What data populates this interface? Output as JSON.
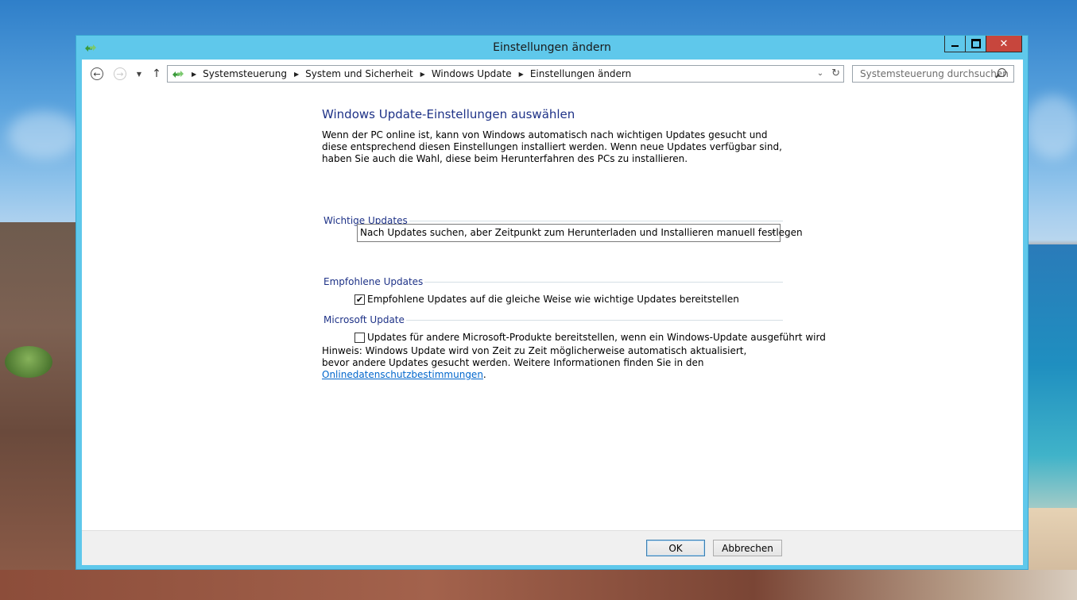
{
  "window": {
    "title": "Einstellungen ändern",
    "close_glyph": "✕"
  },
  "nav": {
    "back_icon": "back-arrow-icon",
    "forward_icon": "forward-arrow-icon",
    "up_icon": "up-arrow-icon",
    "breadcrumbs": [
      "Systemsteuerung",
      "System und Sicherheit",
      "Windows Update",
      "Einstellungen ändern"
    ],
    "search_placeholder": "Systemsteuerung durchsuchen"
  },
  "main": {
    "heading": "Windows Update-Einstellungen auswählen",
    "description": "Wenn der PC online ist, kann von Windows automatisch nach wichtigen Updates gesucht und diese entsprechend diesen Einstellungen installiert werden. Wenn neue Updates verfügbar sind, haben Sie auch die Wahl, diese beim Herunterfahren des PCs zu installieren.",
    "important": {
      "label": "Wichtige Updates",
      "selected": "Nach Updates suchen, aber Zeitpunkt zum Herunterladen und Installieren manuell festlegen"
    },
    "recommended": {
      "label": "Empfohlene Updates",
      "checkbox_label": "Empfohlene Updates auf die gleiche Weise wie wichtige Updates bereitstellen",
      "checked": true
    },
    "microsoft": {
      "label": "Microsoft Update",
      "checkbox_label": "Updates für andere Microsoft-Produkte bereitstellen, wenn ein Windows-Update ausgeführt wird",
      "checked": false
    },
    "note_text": "Hinweis: Windows Update wird von Zeit zu Zeit möglicherweise automatisch aktualisiert, bevor andere Updates gesucht werden. Weitere Informationen finden Sie in den ",
    "note_link": "Onlinedatenschutzbestimmungen",
    "note_end": "."
  },
  "footer": {
    "ok_label": "OK",
    "cancel_label": "Abbrechen"
  },
  "colors": {
    "window_frame": "#5fc8eb",
    "heading": "#1e3287",
    "link": "#0066cc",
    "close_button": "#c7463d"
  }
}
